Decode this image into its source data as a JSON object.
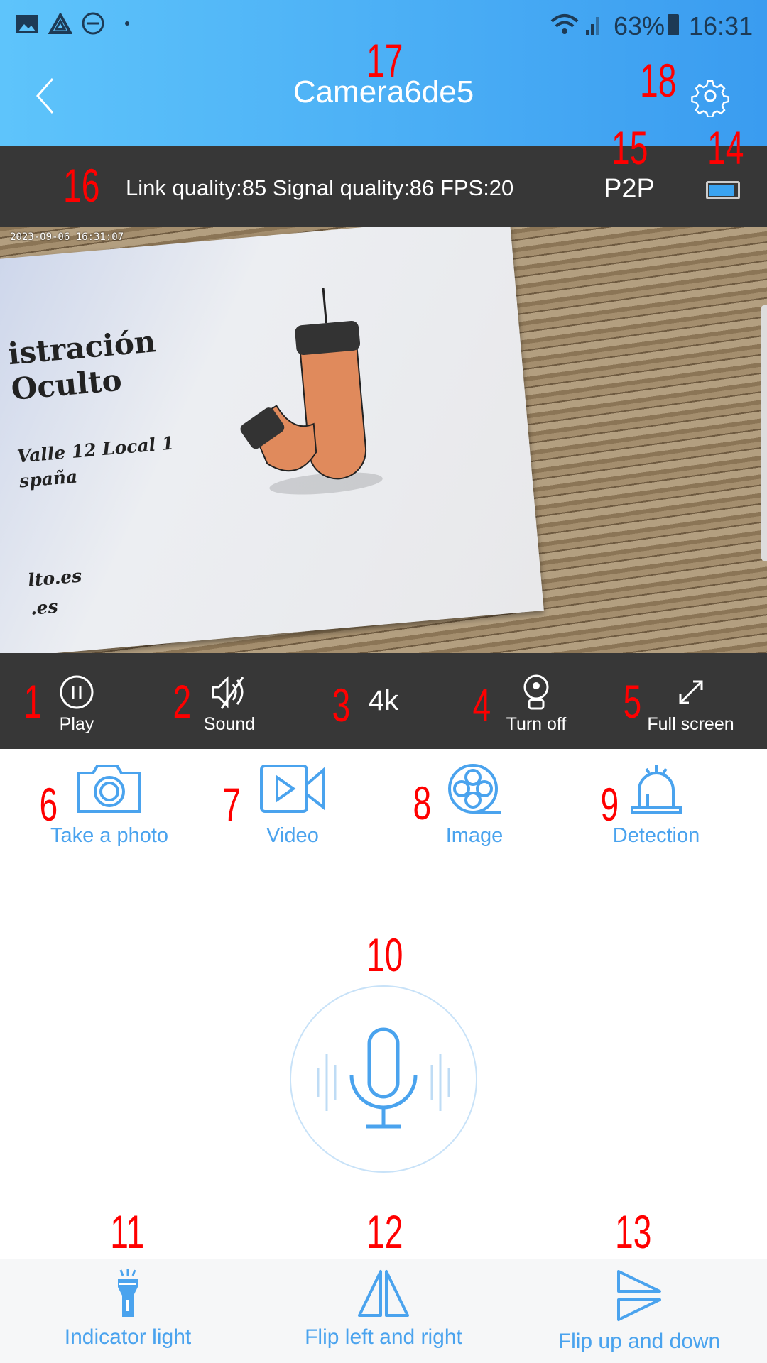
{
  "status_bar": {
    "battery_percent": "63%",
    "time": "16:31",
    "icons": [
      "gallery-icon",
      "drive-icon",
      "dnd-icon",
      "wifi-icon",
      "signal-icon",
      "battery-icon"
    ]
  },
  "header": {
    "title": "Camera6de5",
    "back_icon": "chevron-left-icon",
    "settings_icon": "gear-icon"
  },
  "info_bar": {
    "stats": "Link quality:85 Signal quality:86  FPS:20",
    "mode": "P2P",
    "battery_level": 1.0
  },
  "video": {
    "timestamp": "2023-09-06 16:31:07",
    "card_lines": [
      "istración",
      "Oculto",
      "Valle 12 Local 1",
      "spaña",
      "lto.es",
      ".es"
    ]
  },
  "controls": [
    {
      "label": "Play",
      "icon": "pause-circle-icon"
    },
    {
      "label": "Sound",
      "icon": "sound-muted-icon"
    },
    {
      "label": "4k"
    },
    {
      "label": "Turn off",
      "icon": "camera-off-icon"
    },
    {
      "label": "Full screen",
      "icon": "expand-icon"
    }
  ],
  "features": [
    {
      "label": "Take a photo",
      "icon": "camera-icon"
    },
    {
      "label": "Video",
      "icon": "video-icon"
    },
    {
      "label": "Image",
      "icon": "film-reel-icon"
    },
    {
      "label": "Detection",
      "icon": "alarm-icon"
    }
  ],
  "talk": {
    "icon": "microphone-icon"
  },
  "bottom": [
    {
      "label": "Indicator light",
      "icon": "flashlight-icon"
    },
    {
      "label": "Flip left and right",
      "icon": "flip-horizontal-icon"
    },
    {
      "label": "Flip up and down",
      "icon": "flip-vertical-icon"
    }
  ],
  "annotations": [
    "1",
    "2",
    "3",
    "4",
    "5",
    "6",
    "7",
    "8",
    "9",
    "10",
    "11",
    "12",
    "13",
    "14",
    "15",
    "16",
    "17",
    "18"
  ],
  "colors": {
    "header_start": "#5ec4fb",
    "header_end": "#3a9cf0",
    "bar": "#373737",
    "accent": "#4aa3ee",
    "annotation": "#ff0000"
  }
}
